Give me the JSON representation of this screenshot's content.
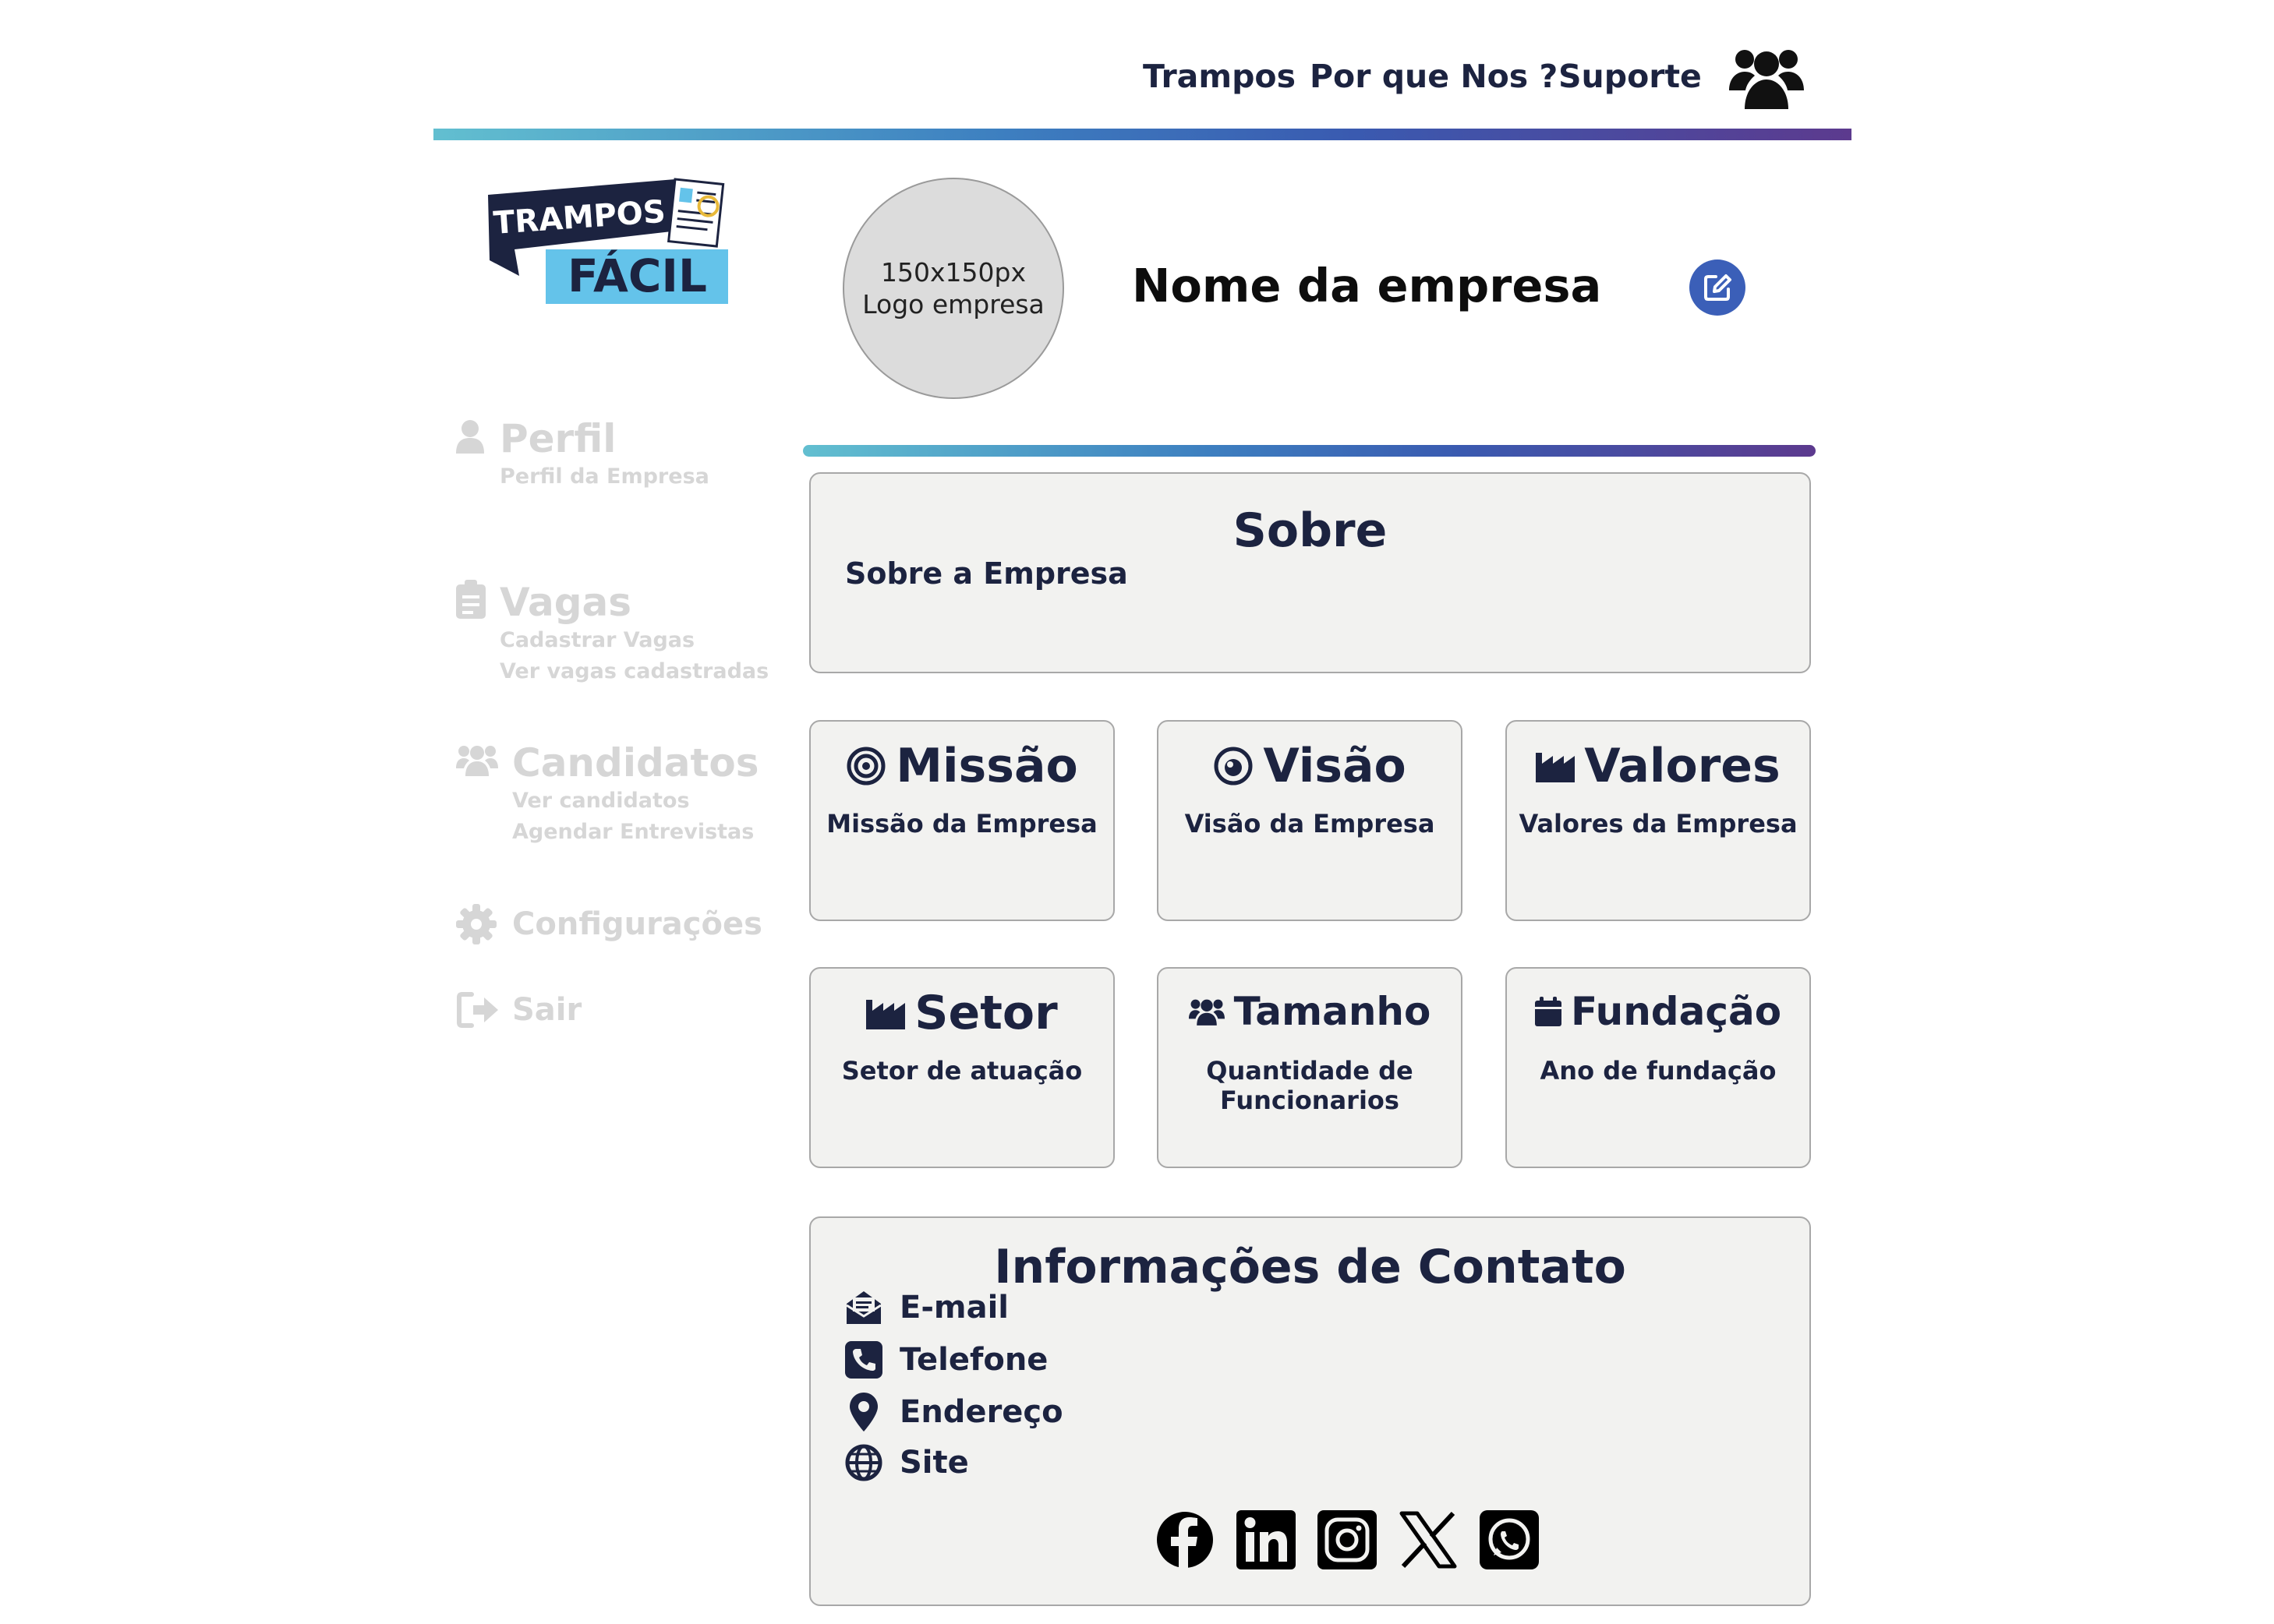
{
  "nav": {
    "items": [
      "Trampos",
      "Por que Nos ?",
      "Suporte"
    ]
  },
  "logo": {
    "line1": "TRAMPOS",
    "line2": "FÁCIL"
  },
  "sidebar": {
    "perfil": {
      "title": "Perfil",
      "subs": [
        "Perfil da Empresa"
      ]
    },
    "vagas": {
      "title": "Vagas",
      "subs": [
        "Cadastrar Vagas",
        "Ver vagas cadastradas"
      ]
    },
    "candidatos": {
      "title": "Candidatos",
      "subs": [
        "Ver candidatos",
        "Agendar Entrevistas"
      ]
    },
    "configuracoes": {
      "title": "Configurações"
    },
    "sair": {
      "title": "Sair"
    }
  },
  "header": {
    "avatar_line1": "150x150px",
    "avatar_line2": "Logo empresa",
    "company_name": "Nome da empresa"
  },
  "sobre": {
    "title": "Sobre",
    "text": "Sobre a Empresa"
  },
  "cards": {
    "missao": {
      "title": "Missão",
      "text": "Missão da Empresa"
    },
    "visao": {
      "title": "Visão",
      "text": "Visão da Empresa"
    },
    "valores": {
      "title": "Valores",
      "text": "Valores da Empresa"
    },
    "setor": {
      "title": "Setor",
      "text": "Setor de atuação"
    },
    "tamanho": {
      "title": "Tamanho",
      "text_line1": "Quantidade de",
      "text_line2": "Funcionarios"
    },
    "fundacao": {
      "title": "Fundação",
      "text": "Ano de fundação"
    }
  },
  "contato": {
    "title": "Informações de Contato",
    "email": "E-mail",
    "telefone": "Telefone",
    "endereco": "Endereço",
    "site": "Site"
  },
  "socials": [
    "facebook-icon",
    "linkedin-icon",
    "instagram-icon",
    "x-icon",
    "whatsapp-icon"
  ],
  "colors": {
    "navy": "#1c2340",
    "muted": "#d6d6d6",
    "card_bg": "#f2f2f0",
    "edit_blue": "#3b5fb8",
    "gradient": [
      "#62bfd0",
      "#3d7fc0",
      "#5c3a8e"
    ]
  }
}
